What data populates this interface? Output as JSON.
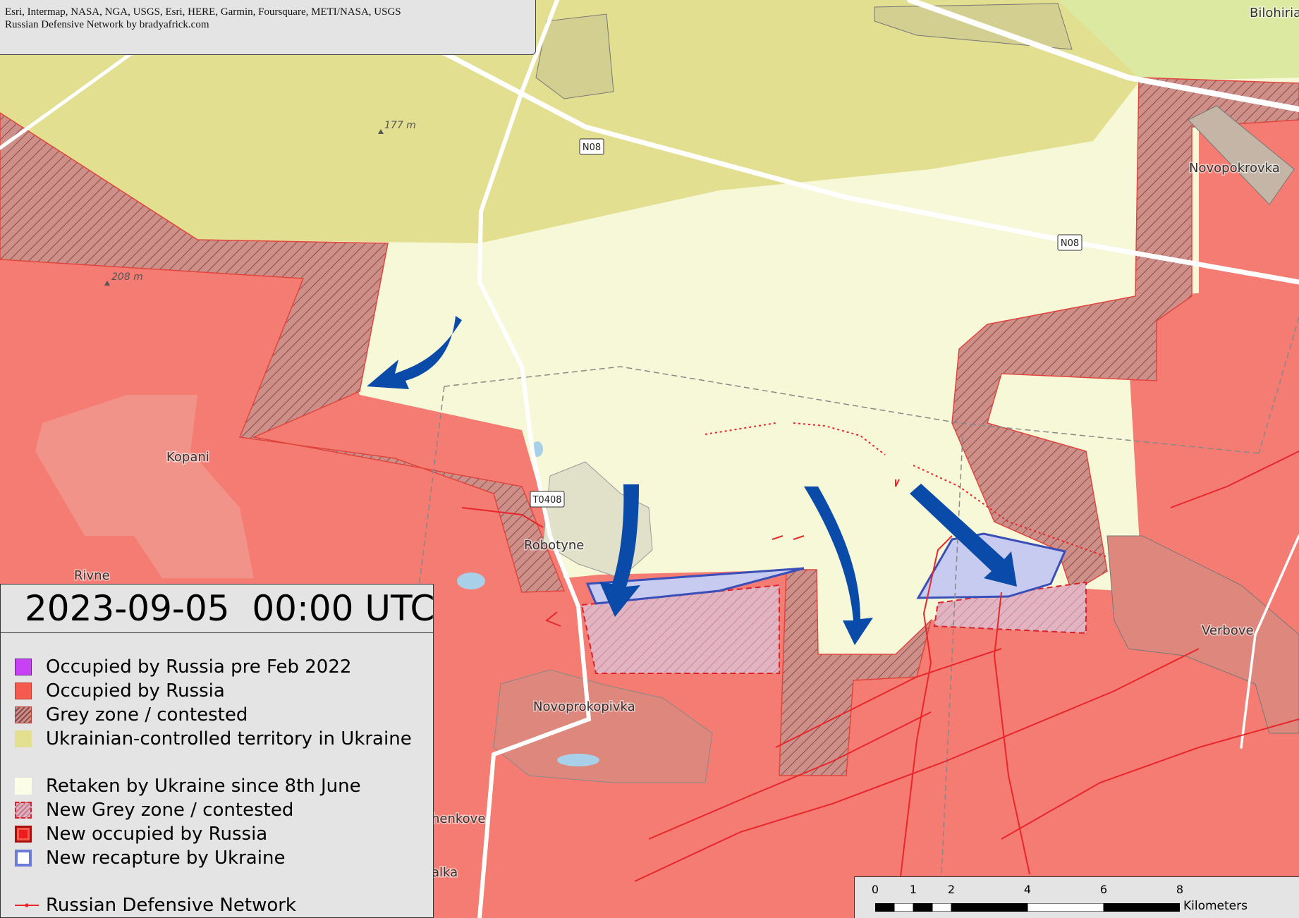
{
  "attribution": {
    "line1": "Esri, Intermap, NASA, NGA, USGS, Esri, HERE, Garmin, Foursquare, METI/NASA, USGS",
    "line2": "Russian Defensive Network by bradyafrick.com"
  },
  "legend": {
    "datetime": "2023-09-05  00:00 UTC",
    "items": [
      {
        "label": "Occupied by Russia pre Feb 2022",
        "color": "#c842f5"
      },
      {
        "label": "Occupied by Russia",
        "color": "#f55a4e"
      },
      {
        "label": "Grey zone / contested",
        "color": "#c9908c"
      },
      {
        "label": "Ukrainian-controlled territory in Ukraine",
        "color": "#e2df90"
      },
      {
        "label": "Retaken by Ukraine since 8th June",
        "color": "#fcfde6"
      },
      {
        "label": "New Grey zone / contested",
        "color": "#e3b0c0"
      },
      {
        "label": "New occupied by Russia",
        "color": "#ee1c1c"
      },
      {
        "label": "New recapture by Ukraine",
        "color": "#6b7bd6"
      },
      {
        "label": "Russian Defensive Network",
        "color": "#e8262b"
      }
    ]
  },
  "places": [
    {
      "name": "Kopani"
    },
    {
      "name": "Robotyne"
    },
    {
      "name": "Novoprokopivka"
    },
    {
      "name": "Verbove"
    },
    {
      "name": "Novopokrovka"
    },
    {
      "name": "Bilohiria"
    },
    {
      "name": "Rivne"
    },
    {
      "name": "henkove"
    },
    {
      "name": "alka"
    }
  ],
  "elevations": [
    "177 m",
    "208 m"
  ],
  "roads": [
    "N08",
    "N08",
    "T0408"
  ],
  "scalebar": {
    "ticks": [
      "0",
      "1",
      "2",
      "4",
      "6",
      "8"
    ],
    "unit": "Kilometers"
  },
  "colors": {
    "ukraine": "#e2df90",
    "retaken": "#f7f8d8",
    "russia": "#f47c72",
    "grey_zone": "#cf8f89",
    "recapture_outline": "#3b4fb8",
    "arrow": "#0a4aa8"
  }
}
